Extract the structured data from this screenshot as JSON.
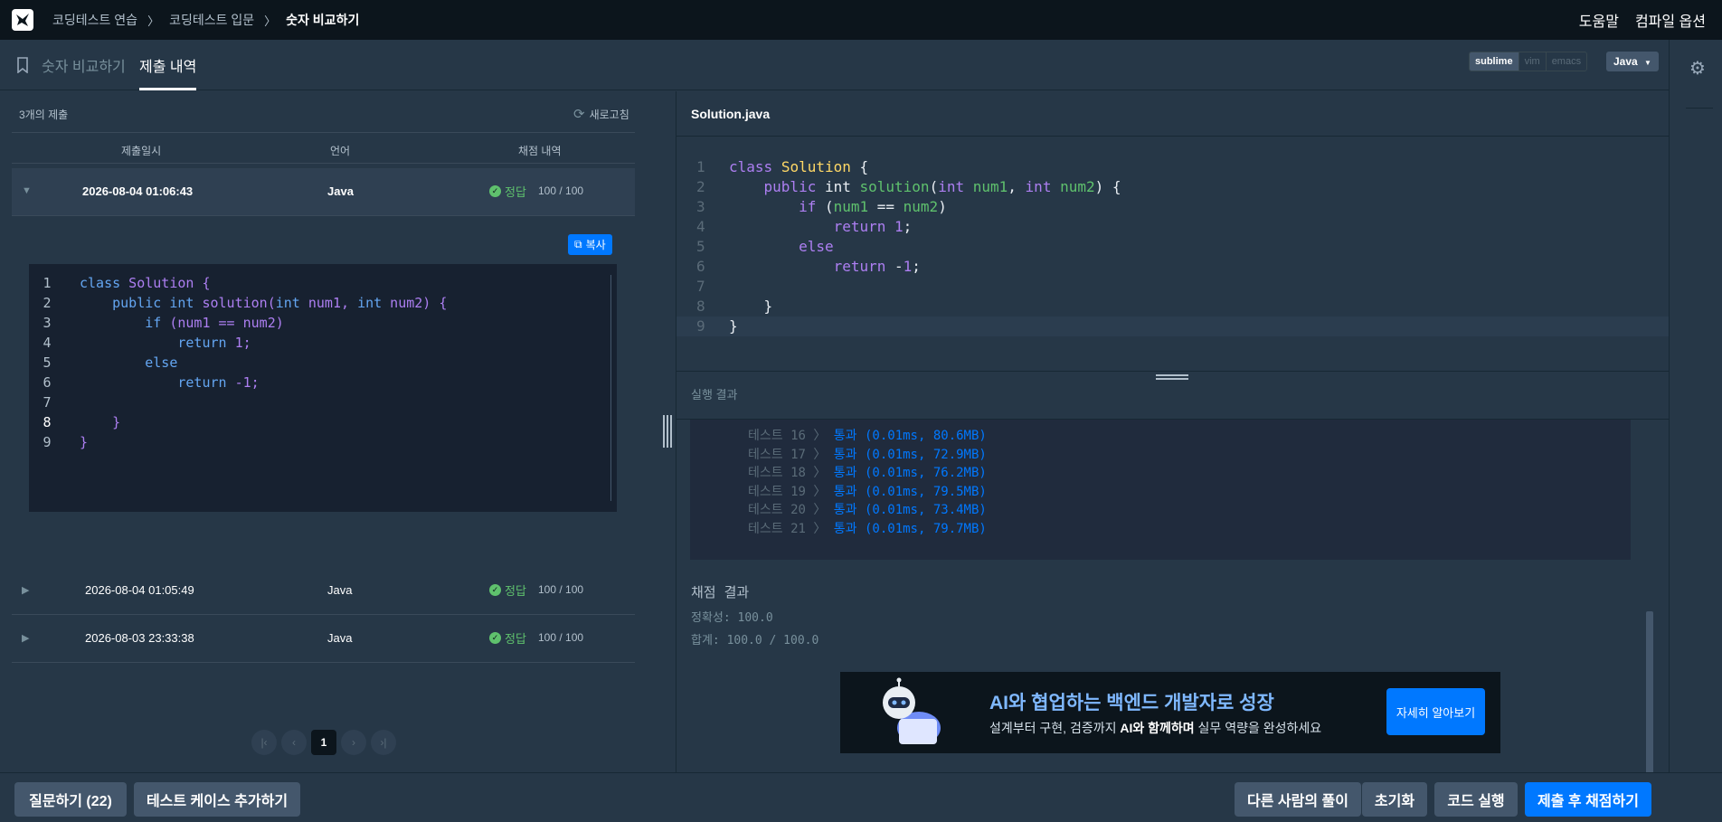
{
  "breadcrumb": {
    "items": [
      "코딩테스트 연습",
      "코딩테스트 입문"
    ],
    "current": "숫자 비교하기"
  },
  "topnav": {
    "help": "도움말",
    "compile_options": "컴파일 옵션"
  },
  "tabs": {
    "problem": "숫자 비교하기",
    "history": "제출 내역"
  },
  "editor_settings": {
    "keymaps": [
      "sublime",
      "vim",
      "emacs"
    ],
    "active_keymap": "sublime",
    "language": "Java"
  },
  "submissions": {
    "count_label": "3개의 제출",
    "refresh": "새로고침",
    "headers": [
      "제출일시",
      "언어",
      "채점 내역"
    ],
    "rows": [
      {
        "date": "2026-08-04 01:06:43",
        "lang": "Java",
        "status": "정답",
        "score": "100 / 100"
      },
      {
        "date": "2026-08-04 01:05:49",
        "lang": "Java",
        "status": "정답",
        "score": "100 / 100"
      },
      {
        "date": "2026-08-03 23:33:38",
        "lang": "Java",
        "status": "정답",
        "score": "100 / 100"
      }
    ],
    "copy": "복사",
    "pagination": {
      "current": "1"
    }
  },
  "code_lines": [
    {
      "n": "1",
      "parts": [
        [
          "kw",
          "class"
        ],
        [
          "pl",
          " Solution {"
        ]
      ]
    },
    {
      "n": "2",
      "parts": [
        [
          "pl",
          "    "
        ],
        [
          "kw",
          "public"
        ],
        [
          "pl",
          " "
        ],
        [
          "kw",
          "int"
        ],
        [
          "pl",
          " solution("
        ],
        [
          "kw",
          "int"
        ],
        [
          "pl",
          " num1, "
        ],
        [
          "kw",
          "int"
        ],
        [
          "pl",
          " num2) {"
        ]
      ]
    },
    {
      "n": "3",
      "parts": [
        [
          "pl",
          "        "
        ],
        [
          "kw",
          "if"
        ],
        [
          "pl",
          " (num1 == num2)"
        ]
      ]
    },
    {
      "n": "4",
      "parts": [
        [
          "pl",
          "            "
        ],
        [
          "kw",
          "return"
        ],
        [
          "pl",
          " "
        ],
        [
          "num",
          "1"
        ],
        [
          "pl",
          ";"
        ]
      ]
    },
    {
      "n": "5",
      "parts": [
        [
          "pl",
          "        "
        ],
        [
          "kw",
          "else"
        ]
      ]
    },
    {
      "n": "6",
      "parts": [
        [
          "pl",
          "            "
        ],
        [
          "kw",
          "return"
        ],
        [
          "pl",
          " -"
        ],
        [
          "num",
          "1"
        ],
        [
          "pl",
          ";"
        ]
      ]
    },
    {
      "n": "7",
      "parts": [
        [
          "pl",
          ""
        ]
      ]
    },
    {
      "n": "8",
      "parts": [
        [
          "pl",
          "    }"
        ]
      ]
    },
    {
      "n": "9",
      "parts": [
        [
          "pl",
          "}"
        ]
      ]
    }
  ],
  "editor": {
    "filename": "Solution.java",
    "lines": [
      {
        "n": "1",
        "parts": [
          [
            "pl",
            "class"
          ],
          [
            "ws",
            " "
          ],
          [
            "ty",
            "Solution"
          ],
          [
            "ws",
            " {"
          ]
        ]
      },
      {
        "n": "2",
        "parts": [
          [
            "ws",
            "    "
          ],
          [
            "pl",
            "public"
          ],
          [
            "ws",
            " int "
          ],
          [
            "fn",
            "solution"
          ],
          [
            "ws",
            "("
          ],
          [
            "pl",
            "int"
          ],
          [
            "ws",
            " "
          ],
          [
            "fn",
            "num1"
          ],
          [
            "ws",
            ", "
          ],
          [
            "pl",
            "int"
          ],
          [
            "ws",
            " "
          ],
          [
            "fn",
            "num2"
          ],
          [
            "ws",
            ") {"
          ]
        ]
      },
      {
        "n": "3",
        "parts": [
          [
            "ws",
            "        "
          ],
          [
            "pl",
            "if"
          ],
          [
            "ws",
            " ("
          ],
          [
            "fn",
            "num1"
          ],
          [
            "ws",
            " == "
          ],
          [
            "fn",
            "num2"
          ],
          [
            "ws",
            ")"
          ]
        ]
      },
      {
        "n": "4",
        "parts": [
          [
            "ws",
            "            "
          ],
          [
            "pl",
            "return"
          ],
          [
            "ws",
            " "
          ],
          [
            "num",
            "1"
          ],
          [
            "ws",
            ";"
          ]
        ]
      },
      {
        "n": "5",
        "parts": [
          [
            "ws",
            "        "
          ],
          [
            "pl",
            "else"
          ]
        ]
      },
      {
        "n": "6",
        "parts": [
          [
            "ws",
            "            "
          ],
          [
            "pl",
            "return"
          ],
          [
            "ws",
            " -"
          ],
          [
            "num",
            "1"
          ],
          [
            "ws",
            ";"
          ]
        ]
      },
      {
        "n": "7",
        "parts": [
          [
            "ws",
            ""
          ]
        ]
      },
      {
        "n": "8",
        "parts": [
          [
            "ws",
            "    }"
          ]
        ]
      },
      {
        "n": "9",
        "parts": [
          [
            "ws",
            "}"
          ]
        ]
      }
    ]
  },
  "results": {
    "label": "실행 결과",
    "tests": [
      {
        "label": "테스트 16 〉",
        "result": "통과 (0.01ms, 80.6MB)"
      },
      {
        "label": "테스트 17 〉",
        "result": "통과 (0.01ms, 72.9MB)"
      },
      {
        "label": "테스트 18 〉",
        "result": "통과 (0.01ms, 76.2MB)"
      },
      {
        "label": "테스트 19 〉",
        "result": "통과 (0.01ms, 79.5MB)"
      },
      {
        "label": "테스트 20 〉",
        "result": "통과 (0.01ms, 73.4MB)"
      },
      {
        "label": "테스트 21 〉",
        "result": "통과 (0.01ms, 79.7MB)"
      }
    ],
    "grade_title": "채점 결과",
    "accuracy": "정확성: 100.0",
    "total": "합계: 100.0 / 100.0"
  },
  "banner": {
    "headline": "AI와 협업하는 백엔드 개발자로 성장",
    "sub_prefix": "설계부터 구현, 검증까지 ",
    "sub_bold": "AI와 함께하며",
    "sub_suffix": " 실무 역량을 완성하세요",
    "cta": "자세히 알아보기"
  },
  "bottom": {
    "ask": "질문하기 (22)",
    "add_testcase": "테스트 케이스 추가하기",
    "others": "다른 사람의 풀이",
    "reset": "초기화",
    "run": "코드 실행",
    "submit": "제출 후 채점하기"
  },
  "colors": {
    "accent": "#0078ff",
    "pass": "#5fc16d",
    "bg": "#263747"
  }
}
